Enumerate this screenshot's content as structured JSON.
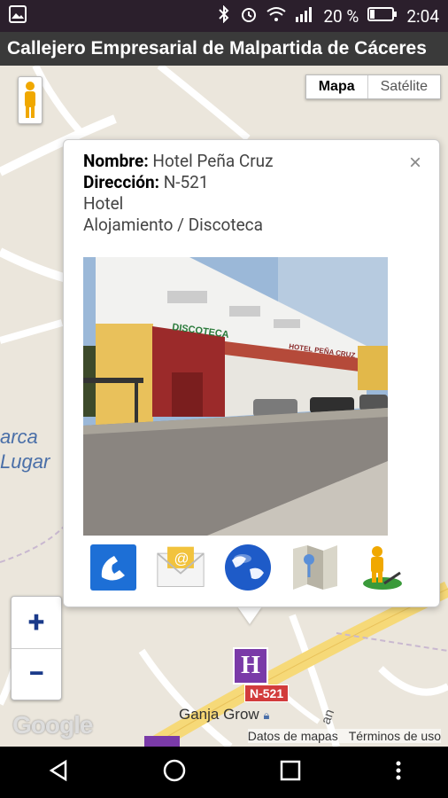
{
  "status_bar": {
    "battery_percent": "20 %",
    "time": "2:04"
  },
  "app": {
    "title": "Callejero Empresarial de Malpartida de Cáceres"
  },
  "map": {
    "type_toggle": {
      "map_label": "Mapa",
      "satellite_label": "Satélite"
    },
    "labels": {
      "park_line1": "arca",
      "park_line2": "Lugar",
      "place": "Ganja Grow",
      "road": "N-521",
      "street": "an"
    },
    "zoom": {
      "in_label": "+",
      "out_label": "−"
    },
    "google_logo": "Google",
    "attribution": {
      "data": "Datos de mapas",
      "terms": "Términos de uso"
    },
    "marker_letter": "H"
  },
  "popup": {
    "close_label": "×",
    "name_label": "Nombre:",
    "name_value": " Hotel Peña Cruz",
    "address_label": "Dirección:",
    "address_value": " N-521",
    "type": "Hotel",
    "category": "Alojamiento / Discoteca",
    "photo_sign": "DISCOTECA",
    "photo_sign2": "HOTEL PEÑA CRUZ",
    "actions": [
      "phone-icon",
      "email-icon",
      "web-globe-icon",
      "map-directions-icon",
      "street-view-icon"
    ]
  },
  "colors": {
    "marker": "#7a3aa8",
    "road_sign": "#d23c3c",
    "zoom": "#1a3a8a"
  }
}
